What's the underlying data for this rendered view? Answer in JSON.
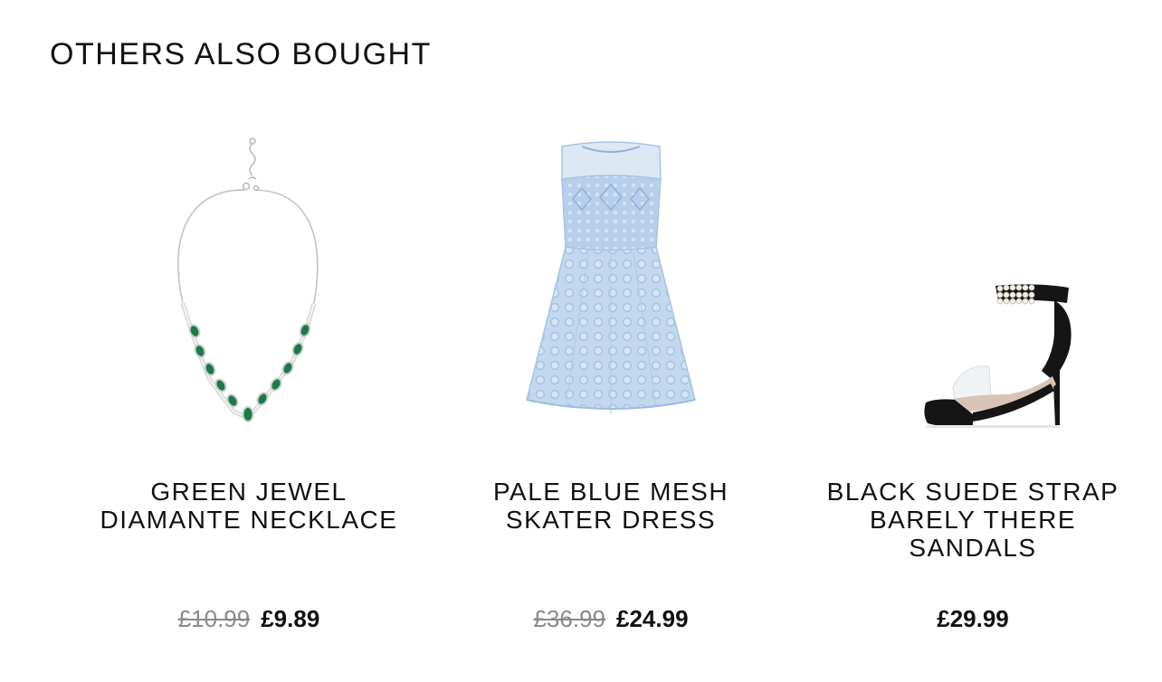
{
  "section": {
    "title": "OTHERS ALSO BOUGHT"
  },
  "products": [
    {
      "name_line1": "GREEN JEWEL",
      "name_line2": "DIAMANTE NECKLACE",
      "name_line3": "",
      "was_price": "£10.99",
      "now_price": "£9.89",
      "image_icon": "necklace-image"
    },
    {
      "name_line1": "PALE BLUE MESH",
      "name_line2": "SKATER DRESS",
      "name_line3": "",
      "was_price": "£36.99",
      "now_price": "£24.99",
      "image_icon": "dress-image"
    },
    {
      "name_line1": "BLACK SUEDE STRAP",
      "name_line2": "BARELY THERE",
      "name_line3": "SANDALS",
      "was_price": "",
      "now_price": "£29.99",
      "image_icon": "sandal-image"
    }
  ],
  "colors": {
    "text": "#111111",
    "was_price": "#8a8a8a",
    "dress_blue": "#bcd3ec",
    "emerald": "#1a7a4a",
    "sandal_black": "#151515"
  }
}
